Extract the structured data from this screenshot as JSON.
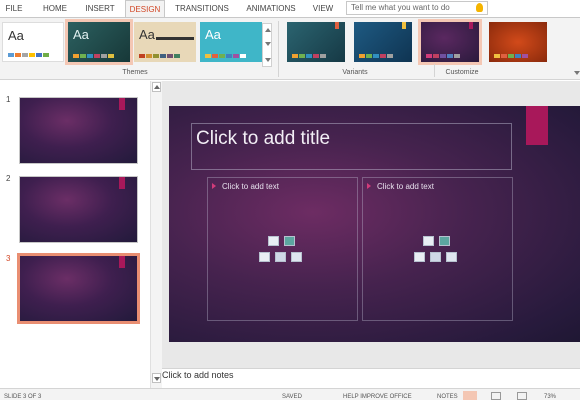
{
  "tabs": [
    {
      "label": "FILE"
    },
    {
      "label": "HOME"
    },
    {
      "label": "INSERT"
    },
    {
      "label": "DESIGN",
      "active": true
    },
    {
      "label": "TRANSITIONS"
    },
    {
      "label": "ANIMATIONS"
    },
    {
      "label": "VIEW"
    }
  ],
  "tell_me": {
    "placeholder": "Tell me what you want to do",
    "icon": "lightbulb-icon"
  },
  "themes": {
    "group_label": "Themes",
    "items": [
      {
        "label": "Aa",
        "name": "office-theme",
        "bg": "#ffffff",
        "fg": "#333333",
        "swatches": [
          "#5b9bd5",
          "#ed7d31",
          "#a5a5a5",
          "#ffc000",
          "#4472c4",
          "#70ad47"
        ]
      },
      {
        "label": "Aa",
        "name": "teal-dark-theme",
        "bg": "#1f4a4a",
        "fg": "#e0f0f0",
        "selected": true,
        "swatches": [
          "#f0a030",
          "#70b050",
          "#3090c0",
          "#c04060",
          "#a0a0a0",
          "#e0c040"
        ]
      },
      {
        "label": "Aa",
        "name": "tan-theme",
        "bg": "#e8d8b8",
        "fg": "#333333",
        "swatches": [
          "#c04020",
          "#d09030",
          "#909030",
          "#406080",
          "#705070",
          "#408060"
        ]
      },
      {
        "label": "Aa",
        "name": "aqua-theme",
        "bg": "#3fb6c8",
        "fg": "#ffffff",
        "swatches": [
          "#f0c040",
          "#e06040",
          "#70b050",
          "#4080c0",
          "#a050a0",
          "#ffffff"
        ]
      }
    ]
  },
  "variants": {
    "group_label": "Variants",
    "items": [
      {
        "name": "variant-teal",
        "bg": "#1d4a55",
        "swatches": [
          "#f0a030",
          "#70b050",
          "#3090c0",
          "#c04060",
          "#a0a0a0"
        ]
      },
      {
        "name": "variant-blue",
        "bg": "#164a6e",
        "swatches": [
          "#f0a030",
          "#70b050",
          "#3090c0",
          "#c04060",
          "#a0a0a0"
        ]
      },
      {
        "name": "variant-purple",
        "bg": "#3d1c4c",
        "selected": true,
        "swatches": [
          "#d23b7a",
          "#c04060",
          "#7050a0",
          "#5080c0",
          "#a0a0a0"
        ]
      },
      {
        "name": "variant-orange",
        "bg": "#b33a12",
        "swatches": [
          "#f0c040",
          "#e06040",
          "#70b050",
          "#4080c0",
          "#a050a0"
        ]
      }
    ]
  },
  "customize": {
    "group_label": "Customize"
  },
  "slides": [
    {
      "number": "1",
      "current": false
    },
    {
      "number": "2",
      "current": false
    },
    {
      "number": "3",
      "current": true
    }
  ],
  "slide": {
    "title_placeholder": "Click to add title",
    "content_left": "Click to add text",
    "content_right": "Click to add text",
    "accent_color": "#a8185a"
  },
  "notes": {
    "placeholder": "Click to add notes"
  },
  "status": {
    "slide_of": "SLIDE 3 OF 3",
    "saved": "SAVED",
    "help": "HELP IMPROVE OFFICE",
    "notes": "NOTES",
    "zoom": "73%"
  },
  "colors": {
    "accent": "#d24726",
    "slide_bg": "#3a1f4a",
    "tag": "#a8185a"
  }
}
